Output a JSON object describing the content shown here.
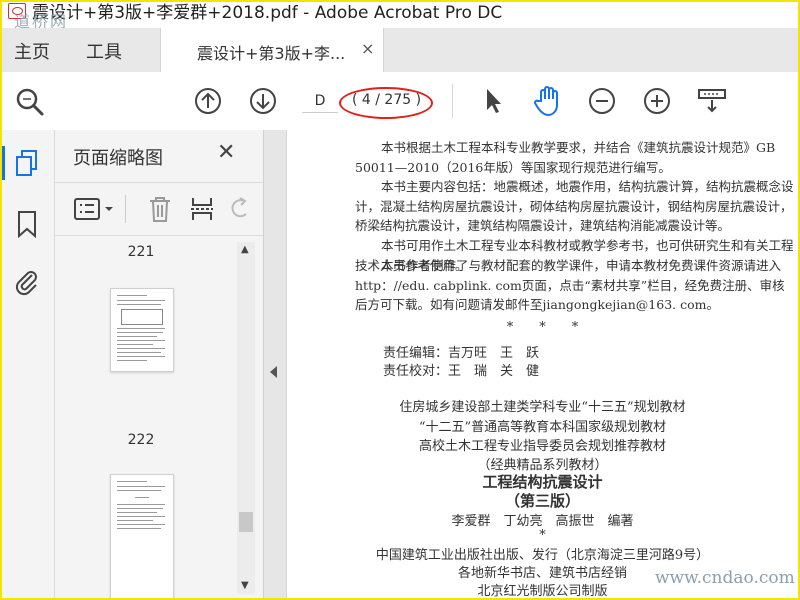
{
  "window": {
    "title": "震设计+第3版+李爱群+2018.pdf - Adobe Acrobat Pro DC",
    "watermark": "道桥网"
  },
  "nav": {
    "home": "主页",
    "tools": "工具"
  },
  "document_tab": {
    "label": "震设计+第3版+李...",
    "close": "×"
  },
  "toolbar": {
    "page_current": "D",
    "page_count": "( 4 / 275 )",
    "icons": [
      "search-icon",
      "arrow-up-circle-icon",
      "arrow-down-circle-icon",
      "pointer-icon",
      "hand-icon",
      "zoom-out-icon",
      "zoom-in-icon",
      "scroll-mode-icon"
    ]
  },
  "left_rail": {
    "icons": [
      "page-thumbnails-icon",
      "bookmark-icon",
      "attachment-icon"
    ]
  },
  "thumbnails_panel": {
    "title": "页面缩略图",
    "close": "✕",
    "pages": [
      {
        "label": "221"
      },
      {
        "label": "222"
      }
    ]
  },
  "document": {
    "para1": "本书根据土木工程本科专业教学要求，并结合《建筑抗震设计规范》GB 50011—2010（2016年版）等国家现行规范进行编写。",
    "para2": "本书主要内容包括：地震概述，地震作用，结构抗震计算，结构抗震概念设计，混凝土结构房屋抗震设计，砌体结构房屋抗震设计，钢结构房屋抗震设计，桥梁结构抗震设计，建筑结构隔震设计，建筑结构消能减震设计等。",
    "para3": "本书可用作土木工程专业本科教材或教学参考书，也可供研究生和有关工程技术人员参考使用。",
    "para4": "本书作者制作了与教材配套的教学课件，申请本教材免费课件资源请进入http：//edu. cabplink. com页面，点击“素材共享”栏目，经免费注册、审核后方可下载。如有问题请发邮件至jiangongkejian@163. com。",
    "separator": "*　　*　　*",
    "editor": "责任编辑：吉万旺　王　跃",
    "proofreader": "责任校对：王　瑞　关　健",
    "series1": "住房城乡建设部土建类学科专业“十三五”规划教材",
    "series2": "“十二五”普通高等教育本科国家级规划教材",
    "series3": "高校土木工程专业指导委员会规划推荐教材",
    "series4": "（经典精品系列教材）",
    "book_title": "工程结构抗震设计",
    "edition": "（第三版）",
    "authors": "李爱群　丁幼亮　高振世　编著",
    "star": "*",
    "publisher": "中国建筑工业出版社出版、发行（北京海淀三里河路9号）",
    "distributor": "各地新华书店、建筑书店经销",
    "printer": "北京红光制版公司制版",
    "watermark": "www.cndao.com"
  },
  "colors": {
    "frame": "#f2e600",
    "annotation": "#e0201c",
    "active": "#1473e6",
    "watermark": "#8aa0b0"
  }
}
